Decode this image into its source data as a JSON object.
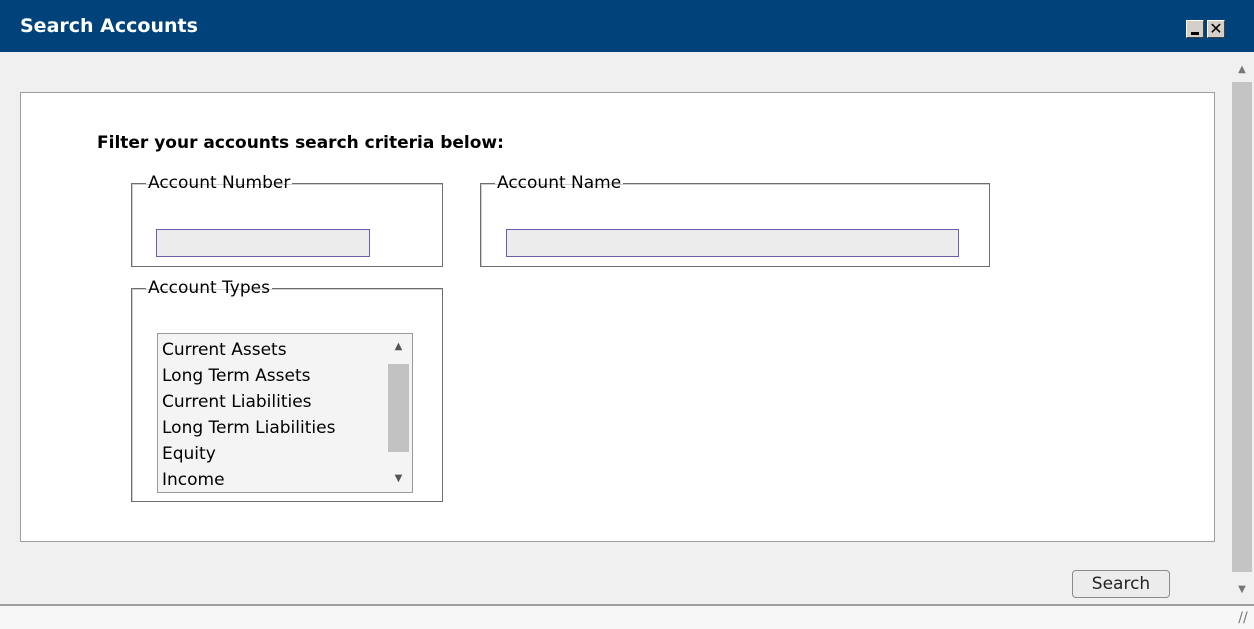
{
  "window": {
    "title": "Search Accounts",
    "minimize_glyph": "",
    "close_glyph": "✕"
  },
  "form": {
    "heading": "Filter your accounts search criteria below:",
    "account_number": {
      "legend": "Account Number",
      "value": ""
    },
    "account_name": {
      "legend": "Account Name",
      "value": ""
    },
    "account_types": {
      "legend": "Account Types",
      "options": [
        "Current Assets",
        "Long Term Assets",
        "Current Liabilities",
        "Long Term Liabilities",
        "Equity",
        "Income"
      ]
    },
    "search_label": "Search"
  },
  "icons": {
    "scroll_up": "▲",
    "scroll_down": "▼",
    "resize_grip": "//"
  }
}
